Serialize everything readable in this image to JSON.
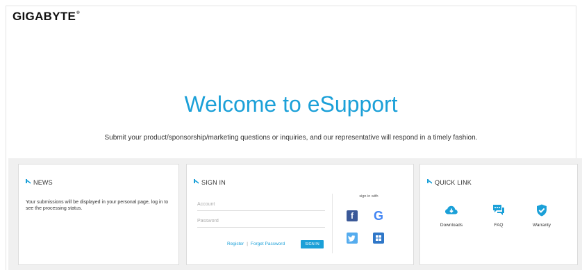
{
  "header": {
    "logo": "GIGABYTE",
    "logo_mark": "®"
  },
  "hero": {
    "title": "Welcome to eSupport",
    "subtitle": "Submit your product/sponsorship/marketing questions or inquiries, and our representative will respond in a timely fashion."
  },
  "news": {
    "title": "NEWS",
    "text": "Your submissions will be displayed in your personal page, log in to see the processing status."
  },
  "signin": {
    "title": "SIGN IN",
    "account_placeholder": "Account",
    "password_placeholder": "Password",
    "signin_with": "sign in with",
    "register": "Register",
    "separator": "|",
    "forget_password": "Forget Password",
    "button": "SIGN IN",
    "social": [
      {
        "name": "facebook",
        "glyph": "f",
        "color": "#3b5998"
      },
      {
        "name": "google",
        "glyph": "G",
        "color": "#4285f4"
      },
      {
        "name": "twitter",
        "glyph": "t",
        "color": "#55acee"
      },
      {
        "name": "windows",
        "glyph": "⊞",
        "color": "#2f77c8"
      }
    ]
  },
  "quicklink": {
    "title": "QUICK LINK",
    "items": [
      {
        "label": "Downloads",
        "icon": "cloud-download-icon"
      },
      {
        "label": "FAQ",
        "icon": "chat-bubbles-icon"
      },
      {
        "label": "Warranty",
        "icon": "shield-check-icon"
      }
    ]
  },
  "colors": {
    "accent": "#1ba0d8",
    "panel_bg": "#f0f0f0"
  }
}
